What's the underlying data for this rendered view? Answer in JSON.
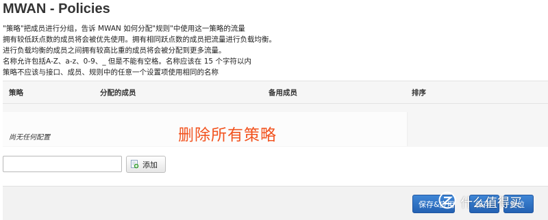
{
  "page": {
    "title": "MWAN - Policies"
  },
  "description": {
    "lines": [
      "\"策略\"把成员进行分组，告诉 MWAN 如何分配\"规则\"中使用这一策略的流量",
      "拥有较低跃点数的成员将会被优先使用。拥有相同跃点数的成员把流量进行负载均衡。",
      "进行负载均衡的成员之间拥有较高比重的成员将会被分配到更多流量。",
      "名称允许包括A-Z、a-z、0-9、_ 但是不能有空格。名称应该在 15 个字符以内",
      "策略不应该与接口、成员、规则中的任意一个设置项使用相同的名称"
    ]
  },
  "table": {
    "columns": [
      "策略",
      "分配的成员",
      "备用成员",
      "排序"
    ],
    "empty_text": "尚无任何配置"
  },
  "overlay_caption": "删除所有策略",
  "add_form": {
    "input_value": "",
    "add_label": "添加",
    "add_icon": "add-icon"
  },
  "footer": {
    "save_apply_label": "保存&应用",
    "save_label": "保存",
    "reset_label": "复位"
  },
  "watermark": {
    "text": "什么值得买",
    "icon": "zhi-logo-icon"
  },
  "colors": {
    "overlay_caption": "#f2531f",
    "primary_button": "#2a6cc0"
  }
}
